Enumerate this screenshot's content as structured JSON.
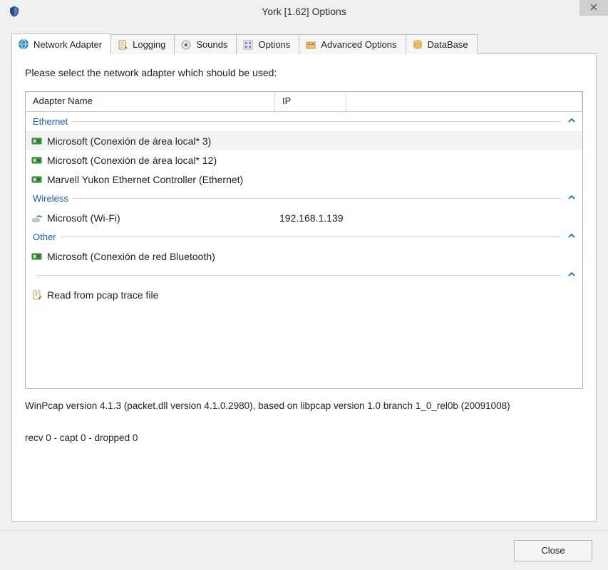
{
  "window": {
    "title": "York [1.62] Options"
  },
  "tabs": [
    {
      "label": "Network Adapter",
      "icon": "globe-icon",
      "active": true
    },
    {
      "label": "Logging",
      "icon": "log-icon",
      "active": false
    },
    {
      "label": "Sounds",
      "icon": "sound-icon",
      "active": false
    },
    {
      "label": "Options",
      "icon": "options-icon",
      "active": false
    },
    {
      "label": "Advanced Options",
      "icon": "advanced-icon",
      "active": false
    },
    {
      "label": "DataBase",
      "icon": "database-icon",
      "active": false
    }
  ],
  "panel": {
    "instruction": "Please select the network adapter which should be used:",
    "columns": {
      "name": "Adapter Name",
      "ip": "IP"
    },
    "groups": [
      {
        "name": "Ethernet",
        "items": [
          {
            "label": "Microsoft (Conexión de área local* 3)",
            "ip": "",
            "icon": "nic-icon",
            "selected": true
          },
          {
            "label": "Microsoft (Conexión de área local* 12)",
            "ip": "",
            "icon": "nic-icon",
            "selected": false
          },
          {
            "label": "Marvell Yukon Ethernet Controller (Ethernet)",
            "ip": "",
            "icon": "nic-icon",
            "selected": false
          }
        ]
      },
      {
        "name": "Wireless",
        "items": [
          {
            "label": "Microsoft (Wi-Fi)",
            "ip": "192.168.1.139",
            "icon": "wifi-icon",
            "selected": false
          }
        ]
      },
      {
        "name": "Other",
        "items": [
          {
            "label": "Microsoft (Conexión de red Bluetooth)",
            "ip": "",
            "icon": "nic-icon",
            "selected": false
          }
        ]
      },
      {
        "name": "",
        "items": [
          {
            "label": "Read from pcap trace file",
            "ip": "",
            "icon": "file-icon",
            "selected": false
          }
        ]
      }
    ],
    "winpcap": "WinPcap version 4.1.3 (packet.dll version 4.1.0.2980), based on libpcap version 1.0 branch 1_0_rel0b (20091008)",
    "stats": "recv 0 - capt 0 - dropped 0"
  },
  "buttons": {
    "close": "Close"
  }
}
